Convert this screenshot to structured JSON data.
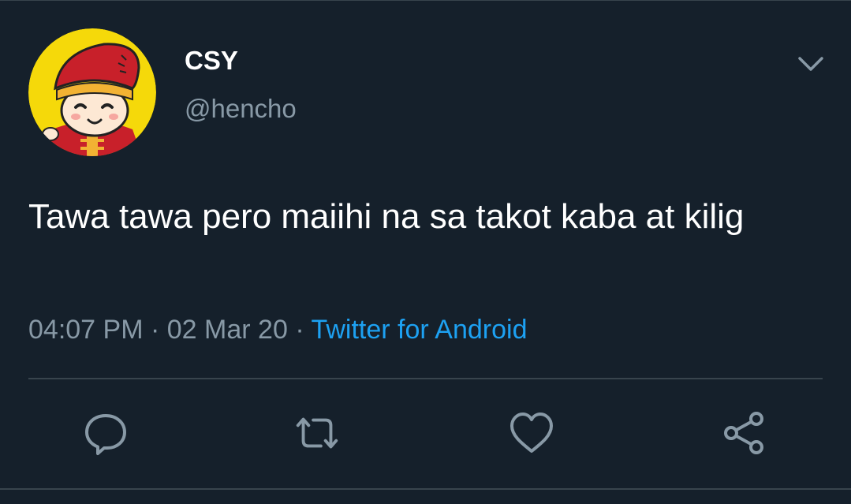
{
  "user": {
    "display_name": "CSY",
    "handle": "@hencho"
  },
  "tweet": {
    "text": "Tawa tawa pero maiihi na sa takot kaba at kilig",
    "time": "04:07 PM",
    "date": "02 Mar 20",
    "separator": "·",
    "source": "Twitter for Android"
  },
  "icons": {
    "more": "chevron-down-icon",
    "reply": "reply-icon",
    "retweet": "retweet-icon",
    "like": "heart-icon",
    "share": "share-icon"
  },
  "colors": {
    "background": "#15202b",
    "accent": "#1da1f2",
    "secondary_text": "#8899a6",
    "divider": "#38444d"
  }
}
